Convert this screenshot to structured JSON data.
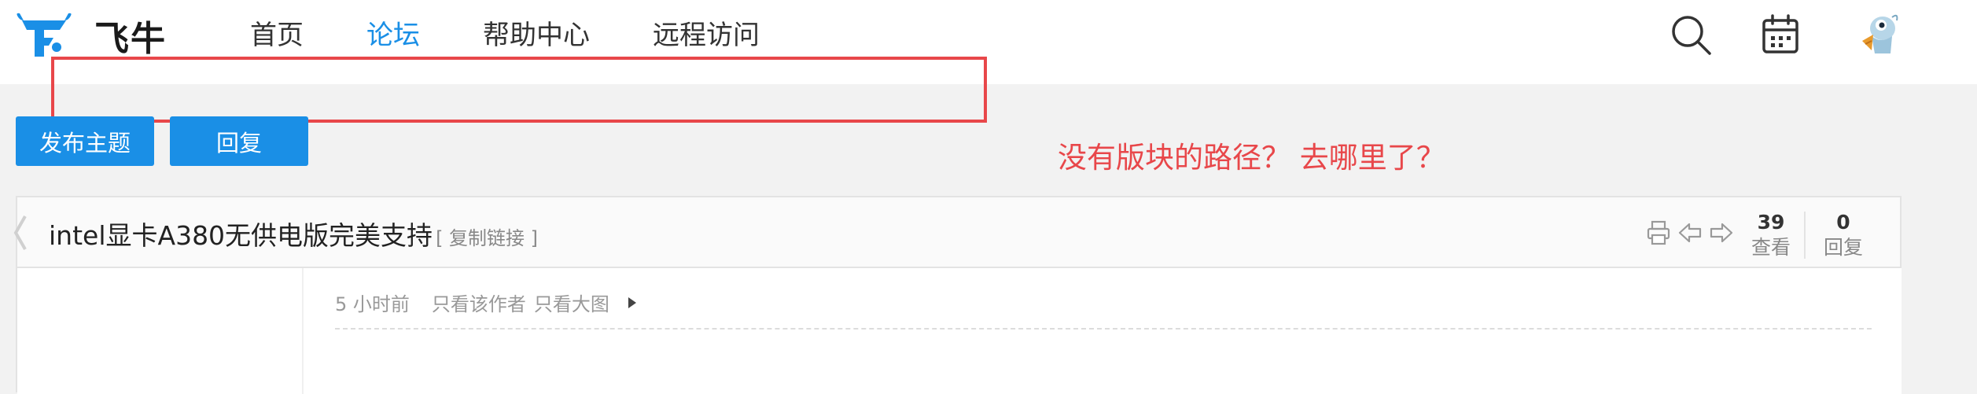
{
  "header": {
    "brand": "飞牛",
    "nav": [
      "首页",
      "论坛",
      "帮助中心",
      "远程访问"
    ],
    "active_nav": "论坛",
    "icons": [
      "search-icon",
      "calendar-icon",
      "avatar"
    ]
  },
  "actions": {
    "post_label": "发布主题",
    "reply_label": "回复"
  },
  "annotation": {
    "text": "没有版块的路径？ 去哪里了？",
    "color": "#e8474a"
  },
  "thread": {
    "title": "intel显卡A380无供电版完美支持",
    "copy_link": "[ 复制链接 ]",
    "views_count": "39",
    "views_label": "查看",
    "replies_count": "0",
    "replies_label": "回复",
    "tool_icons": [
      "print-icon",
      "prev-thread-icon",
      "next-thread-icon"
    ]
  },
  "post": {
    "time": "5 小时前",
    "author_only": "只看该作者",
    "big_image_only": "只看大图"
  },
  "colors": {
    "accent": "#1a8fe6",
    "annotation_red": "#e8474a",
    "page_bg": "#f2f2f2"
  }
}
